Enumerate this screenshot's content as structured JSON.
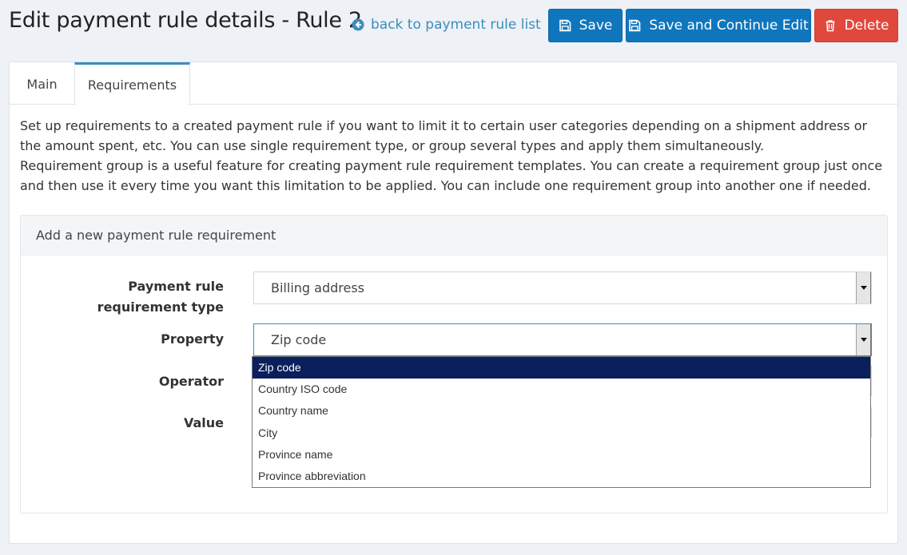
{
  "header": {
    "title": "Edit payment rule details - Rule 2",
    "back_link": "back to payment rule list",
    "save_label": "Save",
    "save_continue_label": "Save and Continue Edit",
    "delete_label": "Delete"
  },
  "tabs": [
    {
      "label": "Main",
      "active": false
    },
    {
      "label": "Requirements",
      "active": true
    }
  ],
  "intro": {
    "paragraph1": "Set up requirements to a created payment rule if you want to limit it to certain user categories depending on a shipment address or the amount spent, etc. You can use single requirement type, or group several types and apply them simultaneously.",
    "paragraph2": "Requirement group is a useful feature for creating payment rule requirement templates. You can create a requirement group just once and then use it every time you want this limitation to be applied. You can include one requirement group into another one if needed."
  },
  "requirement_form": {
    "heading": "Add a new payment rule requirement",
    "type_label": "Payment rule requirement type",
    "type_value": "Billing address",
    "property_label": "Property",
    "property_value": "Zip code",
    "operator_label": "Operator",
    "value_label": "Value",
    "property_options": [
      "Zip code",
      "Country ISO code",
      "Country name",
      "City",
      "Province name",
      "Province abbreviation"
    ],
    "selected_option_index": 0
  },
  "colors": {
    "primary": "#0f76bd",
    "danger": "#e0483b",
    "link": "#3c8dbc",
    "selected_option": "#0a1f5c"
  }
}
